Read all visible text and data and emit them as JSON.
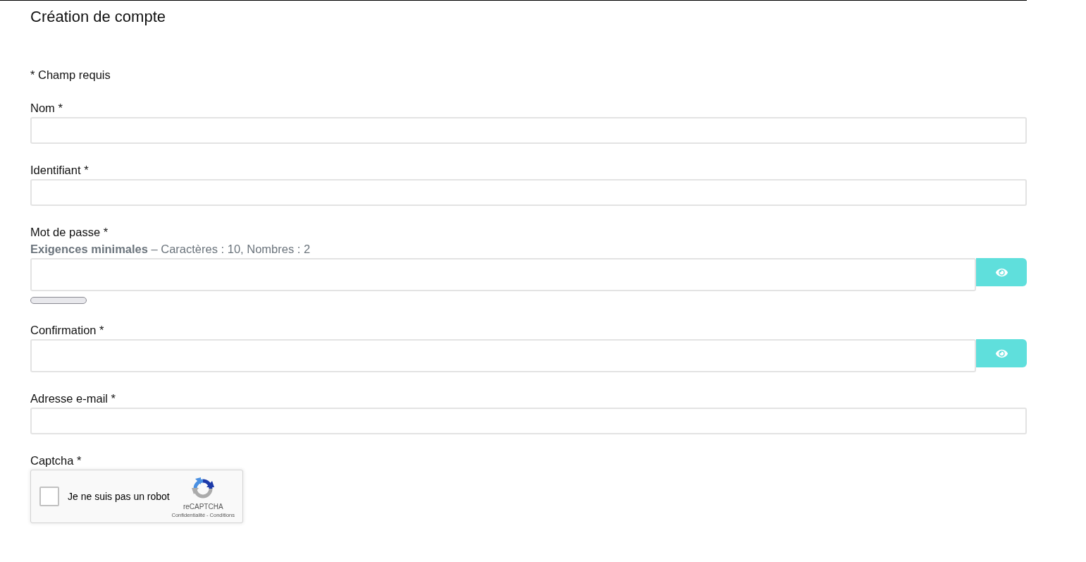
{
  "page": {
    "title": "Création de compte",
    "required_note": "* Champ requis"
  },
  "fields": [
    {
      "kind": "text",
      "label": "Nom *"
    },
    {
      "kind": "text",
      "label": "Identifiant *"
    },
    {
      "kind": "password",
      "label": "Mot de passe *",
      "hint": "**Exigences minimales** – Caractères : 10, Nombres : 2",
      "strength": {
        "level": 0
      }
    },
    {
      "kind": "password",
      "label": "Confirmation *"
    },
    {
      "kind": "text",
      "label": "Adresse e-mail *"
    },
    {
      "kind": "captcha",
      "label": "Captcha *",
      "checkbox": {
        "label": "Je ne suis pas un robot",
        "checked": false
      },
      "brand": "reCAPTCHA",
      "links": [
        "Confidentialité",
        "Conditions"
      ],
      "separator": "-"
    }
  ]
}
